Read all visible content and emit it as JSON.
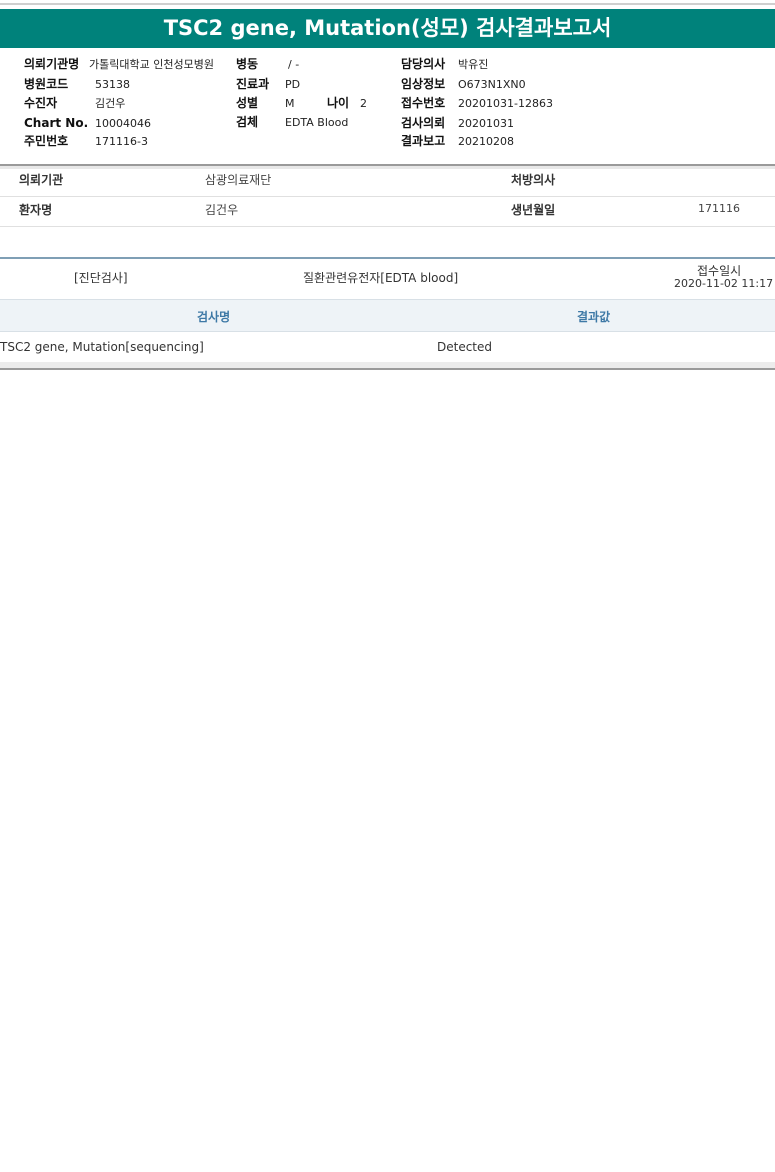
{
  "report": {
    "title": "TSC2 gene, Mutation(성모) 검사결과보고서"
  },
  "header": {
    "col1": [
      {
        "label": "의뢰기관명",
        "value": "가톨릭대학교 인천성모병원"
      },
      {
        "label": "병원코드",
        "value": "53138"
      },
      {
        "label": "수진자",
        "value": "김건우"
      },
      {
        "label": "Chart No.",
        "value": "10004046"
      },
      {
        "label": "주민번호",
        "value": "171116-3"
      }
    ],
    "col2": [
      {
        "label": "병동",
        "value": "/ -"
      },
      {
        "label": "진료과",
        "value": "PD"
      },
      {
        "label": "성별",
        "value": "M"
      },
      {
        "label": "검체",
        "value": "EDTA Blood"
      }
    ],
    "age": {
      "label": "나이",
      "value": "2"
    },
    "col3": [
      {
        "label": "담당의사",
        "value": "박유진"
      },
      {
        "label": "임상정보",
        "value": "O673N1XN0"
      },
      {
        "label": "접수번호",
        "value": "20201031-12863"
      },
      {
        "label": "검사의뢰",
        "value": "20201031"
      },
      {
        "label": "결과보고",
        "value": "20210208"
      }
    ]
  },
  "patient": {
    "institution_label": "의뢰기관",
    "institution_value": "삼광의료재단",
    "doctor_label": "처방의사",
    "doctor_value": "",
    "name_label": "환자명",
    "name_value": "김건우",
    "dob_label": "생년월일",
    "dob_value": "171116"
  },
  "test": {
    "category": "[진단검사]",
    "group": "질환관련유전자[EDTA blood]",
    "received_label": "접수일시",
    "received_value": "2020-11-02 11:17"
  },
  "results": {
    "headers": [
      "검사명",
      "결과값"
    ],
    "rows": [
      {
        "name": "TSC2 gene, Mutation[sequencing]",
        "value": "Detected"
      }
    ]
  },
  "colors": {
    "title_bg": "#00827b",
    "header_text": "#3e79a6"
  }
}
